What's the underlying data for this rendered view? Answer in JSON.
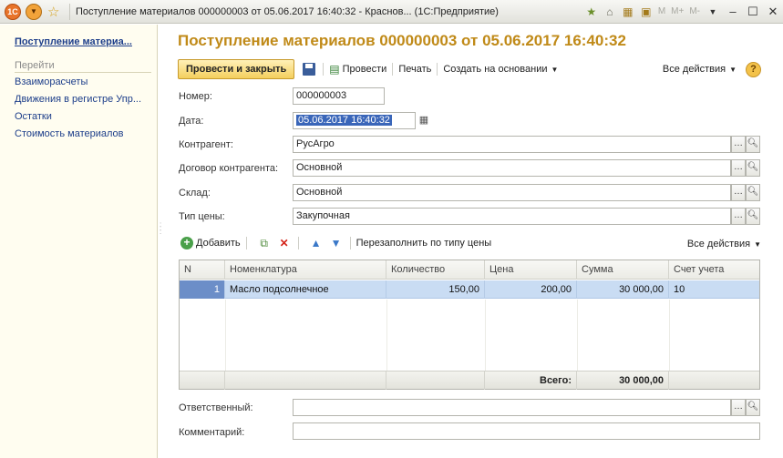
{
  "window": {
    "title": "Поступление материалов 000000003 от 05.06.2017 16:40:32 - Краснов...  (1С:Предприятие)",
    "logo_text": "1С",
    "mem_labels": [
      "M",
      "M+",
      "M-"
    ]
  },
  "left_panel": {
    "title": "Поступление материа...",
    "section": "Перейти",
    "items": [
      "Взаиморасчеты",
      "Движения в регистре Упр...",
      "Остатки",
      "Стоимость материалов"
    ]
  },
  "document": {
    "title": "Поступление материалов 000000003 от 05.06.2017 16:40:32"
  },
  "commands": {
    "post_and_close": "Провести и закрыть",
    "post": "Провести",
    "print": "Печать",
    "create_based_on": "Создать на основании",
    "all_actions": "Все действия",
    "help": "?"
  },
  "form": {
    "number_label": "Номер:",
    "number_value": "000000003",
    "date_label": "Дата:",
    "date_value": "05.06.2017 16:40:32",
    "counterparty_label": "Контрагент:",
    "counterparty_value": "РусАгро",
    "contract_label": "Договор контрагента:",
    "contract_value": "Основной",
    "warehouse_label": "Склад:",
    "warehouse_value": "Основной",
    "price_type_label": "Тип цены:",
    "price_type_value": "Закупочная",
    "responsible_label": "Ответственный:",
    "responsible_value": "",
    "comment_label": "Комментарий:",
    "comment_value": ""
  },
  "table_toolbar": {
    "add": "Добавить",
    "refill": "Перезаполнить по типу цены",
    "all_actions": "Все действия"
  },
  "table": {
    "columns": [
      "N",
      "Номенклатура",
      "Количество",
      "Цена",
      "Сумма",
      "Счет учета"
    ],
    "rows": [
      [
        "1",
        "Масло подсолнечное",
        "150,00",
        "200,00",
        "30 000,00",
        "10"
      ]
    ],
    "total_label": "Всего:",
    "total_value": "30 000,00"
  }
}
